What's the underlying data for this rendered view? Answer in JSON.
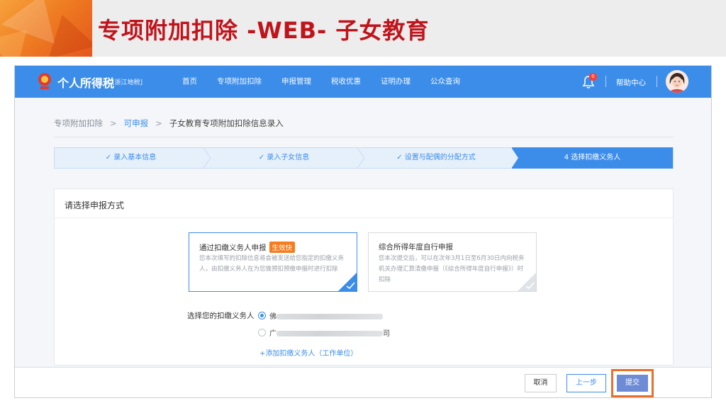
{
  "slide": {
    "title": "专项附加扣除 -WEB- 子女教育"
  },
  "navbar": {
    "logo_text": "个人所得税",
    "region": "[浙江地税]",
    "items": [
      "首页",
      "专项附加扣除",
      "申报管理",
      "税收优惠",
      "证明办理",
      "公众查询"
    ],
    "notification_count": "0",
    "help": "帮助中心"
  },
  "breadcrumb": {
    "items": [
      "专项附加扣除",
      "可申报",
      "子女教育专项附加扣除信息录入"
    ]
  },
  "steps": [
    {
      "label": "录入基本信息",
      "status": "done"
    },
    {
      "label": "录入子女信息",
      "status": "done"
    },
    {
      "label": "设置与配偶的分配方式",
      "status": "done"
    },
    {
      "label": "4 选择扣缴义务人",
      "status": "active"
    }
  ],
  "card": {
    "title": "请选择申报方式",
    "options": [
      {
        "title": "通过扣缴义务人申报",
        "tag": "生效快",
        "desc": "您本次填写的扣除信息将会被发送给您指定的扣缴义务人，由扣缴义务人在为您做预扣预缴申报时进行扣除",
        "selected": true
      },
      {
        "title": "综合所得年度自行申报",
        "tag": "",
        "desc": "您本次提交后，可以在次年3月1日至6月30日内向税务机关办理汇算清缴申报（《综合所得年度自行申报》）时扣除",
        "selected": false
      }
    ],
    "agent_label": "选择您的扣缴义务人",
    "agents": [
      {
        "visible_prefix": "佛",
        "visible_suffix": "",
        "selected": true
      },
      {
        "visible_prefix": "广",
        "visible_suffix": "司",
        "selected": false
      }
    ],
    "add_agent": "+添加扣缴义务人（工作单位）"
  },
  "footer": {
    "cancel": "取消",
    "prev": "上一步",
    "submit": "提交"
  },
  "colors": {
    "primary": "#3c8dea",
    "accent_orange": "#f57c1f",
    "title_red": "#c0141c",
    "highlight_box": "#e8702a"
  }
}
